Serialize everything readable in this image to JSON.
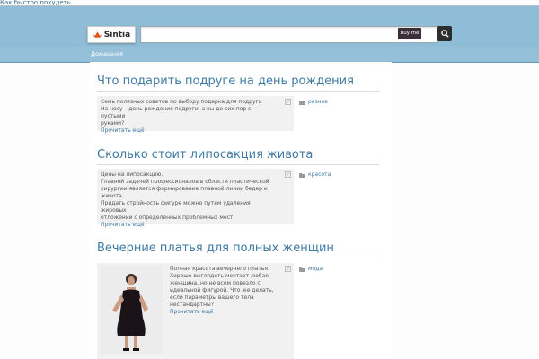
{
  "top_link": "Как быстро похудеть",
  "header": {
    "logo_text": "Sintia",
    "search_placeholder": "",
    "buy_label": "Buy me",
    "nav": {
      "home_label": "Домашняя"
    }
  },
  "posts": [
    {
      "title": "Что подарить подруге на день рождения",
      "lines": [
        "Семь полезных советов по выбору подарка для подруги",
        "На носу – день рождения подруги, а вы до сих пор с пустыми",
        "руками?"
      ],
      "read_more": "Прочитать ещё",
      "category": "разное"
    },
    {
      "title": "Сколько стоит липосакция живота",
      "lines": [
        "Цены на липосакцию.",
        "Главной задачей профессионалов в области пластической",
        "хирургии является формирование плавной линии бедер и",
        "живота.",
        "Придать стройность фигуре можно путем удаления жировых",
        "отложений с определенных проблемных мест."
      ],
      "read_more": "Прочитать ещё",
      "category": "красота"
    },
    {
      "title": "Вечерние платья для полных женщин",
      "lines": [
        "Полная красота вечернего платья.",
        "Хорошо выглядеть мечтает любая",
        "женщина, но не всем повезло с",
        "идеальной фигурой. Что же делать,",
        "если параметры вашего тела",
        "нестандартны?"
      ],
      "read_more": "Прочитать ещё",
      "category": "мода",
      "thumbnail": "woman-in-black-dress-photo"
    }
  ],
  "icons": {
    "logo": "flame-crown-icon",
    "search": "magnifier-icon",
    "edit": "edit-pencil-icon",
    "category": "folder-icon"
  },
  "colors": {
    "header": "#8fbcd6",
    "link": "#3e7aa3",
    "excerpt_bg": "#f1f1f1"
  }
}
